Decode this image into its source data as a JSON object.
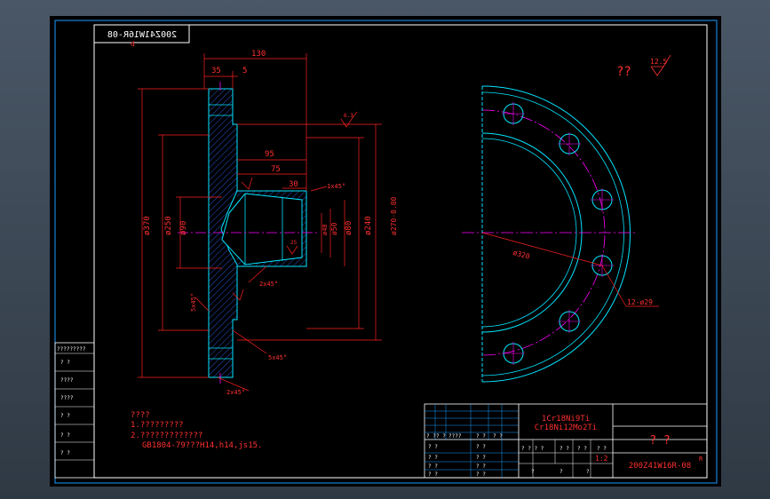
{
  "drawing": {
    "drawing_number_mirrored": "200Z41W16R-08",
    "roughness_value": "12.5",
    "roughness_prefix": "??",
    "dimensions": {
      "d130": "130",
      "d35": "35",
      "d5": "5",
      "d95": "95",
      "d75": "75",
      "d30": "30",
      "d1x45": "1x45°",
      "d370": "ø370",
      "d250": "ø250",
      "d90": "ø90",
      "d48": "ø48",
      "d50": "ø50",
      "d80": "ø80",
      "d240": "ø240",
      "d270": "ø270-0.80",
      "d2x45a": "2x45°",
      "d5x45a": "5x45°",
      "d5x45b": "5x45°",
      "d2x45b": "2x45°",
      "d320": "ø320",
      "holes": "12-ø29",
      "r63": "6.3",
      "r25": "25",
      "r12": "12.5"
    },
    "notes": {
      "title": "????",
      "line1": "1.?????????",
      "line2": "2.?????????????",
      "line3": "GB1804-79???H14,h14,js15."
    },
    "left_strip": [
      "?????????",
      "? ?",
      "????",
      "????",
      "? ?",
      "? ?",
      "? ?"
    ],
    "title_block": {
      "material1": "1Cr18Ni9Ti",
      "material2": "Cr18Ni12Mo2Ti",
      "name": "?  ?",
      "code": "200Z41W16R-08",
      "code_small": "R",
      "scale": "1:2",
      "header_cells": [
        "? ?",
        "? ?",
        "????",
        "? ?",
        "? ?"
      ],
      "row_cells": [
        "? ?",
        "? ?",
        "? ?"
      ],
      "weight_cells": [
        "? ? ? ?",
        "? ?",
        "? ?",
        "? ?"
      ],
      "bottom_cells": [
        "?",
        "?",
        "?"
      ]
    }
  }
}
